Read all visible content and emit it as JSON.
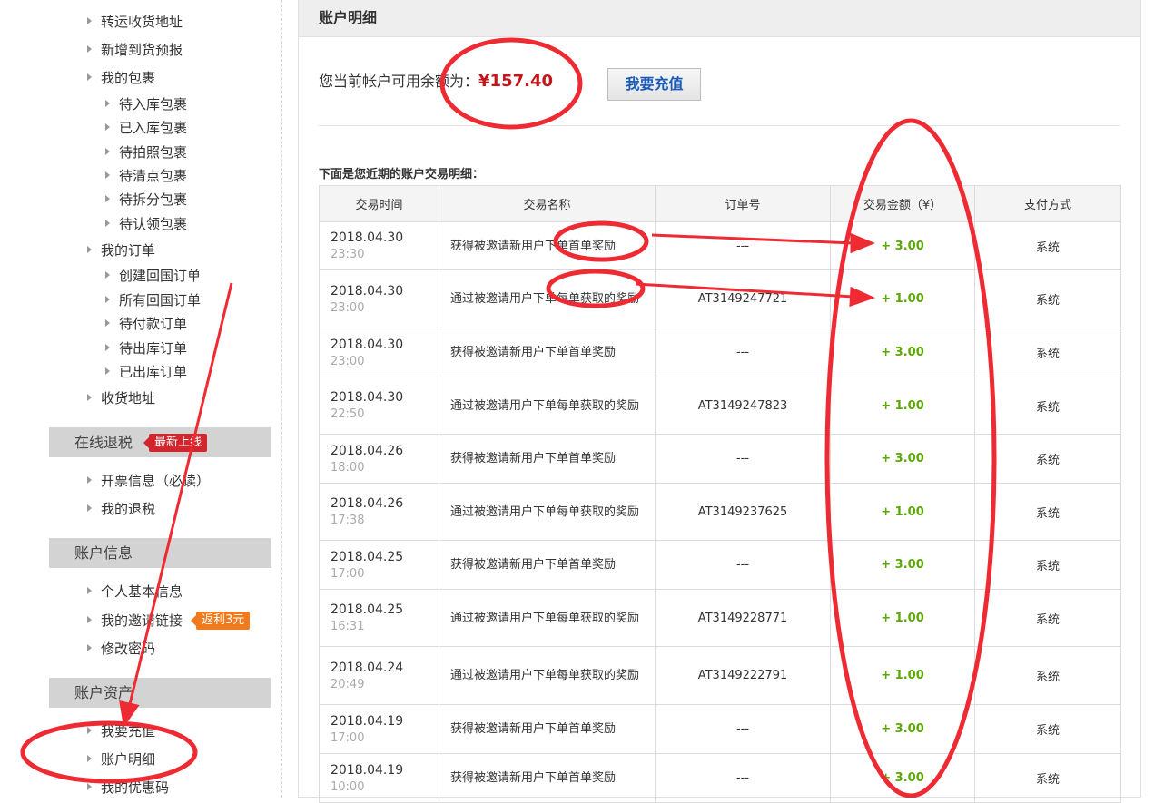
{
  "sidebar": {
    "items": [
      {
        "label": "转运收货地址"
      },
      {
        "label": "新增到货预报"
      },
      {
        "label": "我的包裹"
      },
      {
        "label": "待入库包裹"
      },
      {
        "label": "已入库包裹"
      },
      {
        "label": "待拍照包裹"
      },
      {
        "label": "待清点包裹"
      },
      {
        "label": "待拆分包裹"
      },
      {
        "label": "待认领包裹"
      },
      {
        "label": "我的订单"
      },
      {
        "label": "创建回国订单"
      },
      {
        "label": "所有回国订单"
      },
      {
        "label": "待付款订单"
      },
      {
        "label": "待出库订单"
      },
      {
        "label": "已出库订单"
      },
      {
        "label": "收货地址"
      }
    ],
    "tax_section": {
      "title": "在线退税",
      "badge": "最新上线",
      "items": [
        {
          "label": "开票信息（必读）"
        },
        {
          "label": "我的退税"
        }
      ]
    },
    "account_section": {
      "title": "账户信息",
      "items": [
        {
          "label": "个人基本信息"
        },
        {
          "label": "我的邀请链接"
        },
        {
          "label": "修改密码"
        }
      ],
      "badge": "返利3元"
    },
    "assets_section": {
      "title": "账户资产",
      "items": [
        {
          "label": "我要充值"
        },
        {
          "label": "账户明细"
        },
        {
          "label": "我的优惠码"
        }
      ]
    }
  },
  "main": {
    "title": "账户明细",
    "balance_label": "您当前帐户可用余额为：",
    "balance_amount": "¥157.40",
    "recharge_button": "我要充值",
    "caption": "下面是您近期的账户交易明细：",
    "columns": [
      "交易时间",
      "交易名称",
      "订单号",
      "交易金额（¥）",
      "支付方式"
    ],
    "rows": [
      {
        "date": "2018.04.30",
        "time": "23:30",
        "name": "获得被邀请新用户下单首单奖励",
        "order": "---",
        "amount": "+ 3.00",
        "pay": "系统"
      },
      {
        "date": "2018.04.30",
        "time": "23:00",
        "name": "通过被邀请用户下单每单获取的奖励",
        "order": "AT3149247721",
        "amount": "+ 1.00",
        "pay": "系统"
      },
      {
        "date": "2018.04.30",
        "time": "23:00",
        "name": "获得被邀请新用户下单首单奖励",
        "order": "---",
        "amount": "+ 3.00",
        "pay": "系统"
      },
      {
        "date": "2018.04.30",
        "time": "22:50",
        "name": "通过被邀请用户下单每单获取的奖励",
        "order": "AT3149247823",
        "amount": "+ 1.00",
        "pay": "系统"
      },
      {
        "date": "2018.04.26",
        "time": "18:00",
        "name": "获得被邀请新用户下单首单奖励",
        "order": "---",
        "amount": "+ 3.00",
        "pay": "系统"
      },
      {
        "date": "2018.04.26",
        "time": "17:38",
        "name": "通过被邀请用户下单每单获取的奖励",
        "order": "AT3149237625",
        "amount": "+ 1.00",
        "pay": "系统"
      },
      {
        "date": "2018.04.25",
        "time": "17:00",
        "name": "获得被邀请新用户下单首单奖励",
        "order": "---",
        "amount": "+ 3.00",
        "pay": "系统"
      },
      {
        "date": "2018.04.25",
        "time": "16:31",
        "name": "通过被邀请用户下单每单获取的奖励",
        "order": "AT3149228771",
        "amount": "+ 1.00",
        "pay": "系统"
      },
      {
        "date": "2018.04.24",
        "time": "20:49",
        "name": "通过被邀请用户下单每单获取的奖励",
        "order": "AT3149222791",
        "amount": "+ 1.00",
        "pay": "系统"
      },
      {
        "date": "2018.04.19",
        "time": "17:00",
        "name": "获得被邀请新用户下单首单奖励",
        "order": "---",
        "amount": "+ 3.00",
        "pay": "系统"
      },
      {
        "date": "2018.04.19",
        "time": "10:00",
        "name": "获得被邀请新用户下单首单奖励",
        "order": "---",
        "amount": "+ 3.00",
        "pay": "系统"
      }
    ]
  },
  "colors": {
    "annotation": "#ee2a33",
    "amount_green": "#5aa700",
    "balance_red": "#c4161c",
    "link_blue": "#1a5bb8"
  }
}
